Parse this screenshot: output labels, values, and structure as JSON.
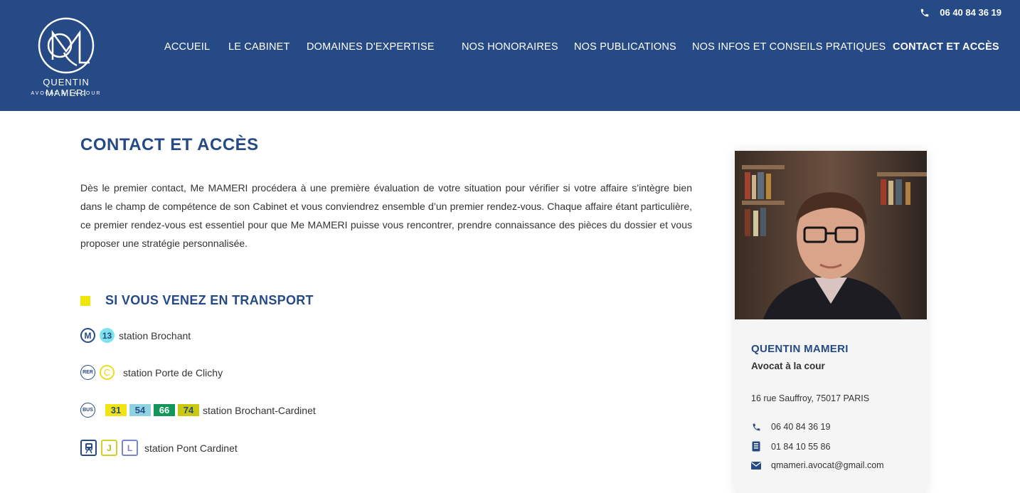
{
  "header": {
    "logo": {
      "name": "QUENTIN MAMERI",
      "subtitle": "AVOCAT À LA COUR",
      "icon": "monogram-logo"
    },
    "top_phone": "06 40 84 36 19",
    "nav": [
      {
        "label": "ACCUEIL",
        "active": false
      },
      {
        "label": "LE CABINET",
        "active": false
      },
      {
        "label": "DOMAINES D'EXPERTISE",
        "active": false
      },
      {
        "label": "NOS HONORAIRES",
        "active": false
      },
      {
        "label": "NOS PUBLICATIONS",
        "active": false
      },
      {
        "label": "NOS INFOS ET CONSEILS PRATIQUES",
        "active": false
      },
      {
        "label": "CONTACT ET ACCÈS",
        "active": true
      }
    ]
  },
  "main": {
    "title": "CONTACT ET ACCÈS",
    "intro": "Dès le premier contact, Me MAMERI procédera à une première évaluation de votre situation pour vérifier si votre affaire s’intègre bien dans le champ de compétence de son Cabinet et vous conviendrez ensemble d’un premier rendez-vous. Chaque affaire étant particulière, ce premier rendez-vous est essentiel pour que Me MAMERI puisse vous rencontrer, prendre connaissance des pièces du dossier et vous proposer une stratégie personnalisée.",
    "transport_title": "SI VOUS VENEZ EN TRANSPORT",
    "transport": {
      "metro": {
        "mode": "M",
        "line": "13",
        "station": "station Brochant"
      },
      "rer": {
        "mode": "RER",
        "line": "C",
        "station": "station Porte de Clichy"
      },
      "bus": {
        "mode": "BUS",
        "lines": [
          "31",
          "54",
          "66",
          "74"
        ],
        "station": "station Brochant-Cardinet"
      },
      "train": {
        "lines": [
          "J",
          "L"
        ],
        "station": "station Pont Cardinet"
      }
    }
  },
  "card": {
    "name": "QUENTIN MAMERI",
    "role": "Avocat à la cour",
    "address": "16 rue Sauffroy, 75017 PARIS",
    "phone": "06 40 84 36 19",
    "fax": "01 84 10 55 86",
    "email": "qmameri.avocat@gmail.com"
  },
  "colors": {
    "brand": "#264a85",
    "accent_yellow": "#f0e60c",
    "bus_31": "#f2e412",
    "bus_54": "#8fd3e0",
    "bus_66": "#13965c",
    "bus_74": "#c9c910",
    "line_j": "#cfd126",
    "line_l": "#7b86c8"
  }
}
